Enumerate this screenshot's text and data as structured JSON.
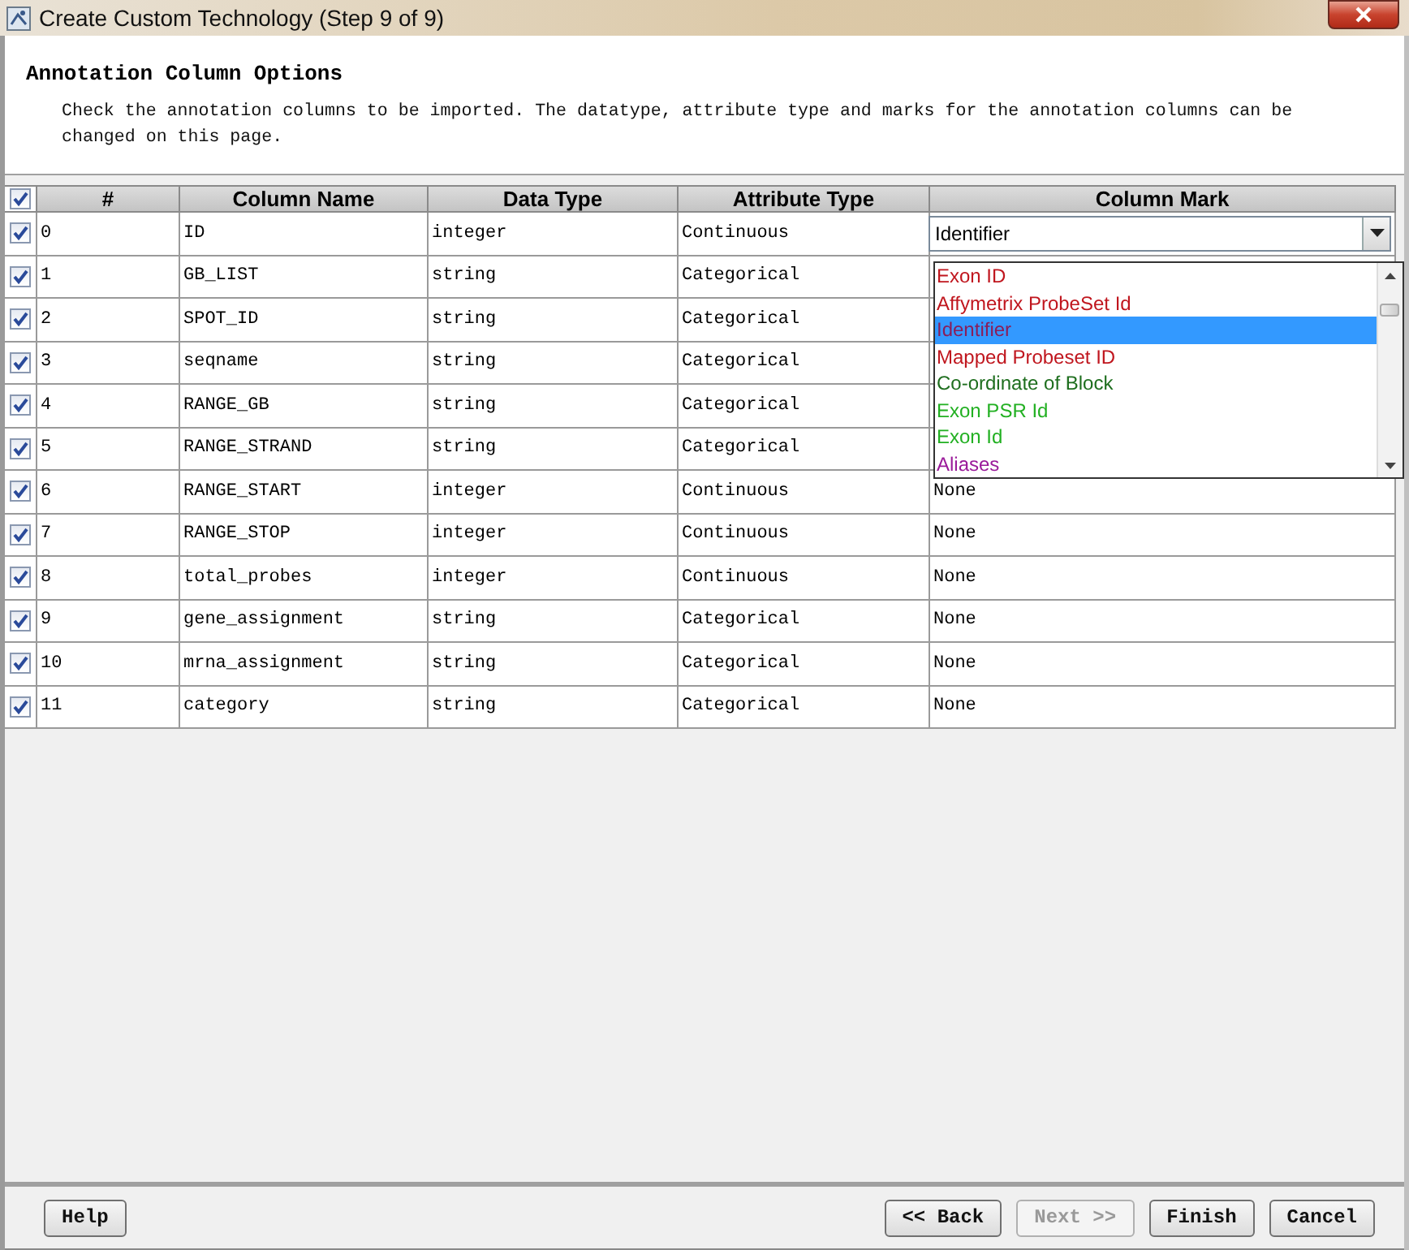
{
  "window": {
    "title": "Create Custom Technology (Step 9 of 9)"
  },
  "header": {
    "title": "Annotation Column Options",
    "description": "Check the annotation columns to be imported. The datatype, attribute type and marks for the annotation columns can be changed on this page."
  },
  "table": {
    "select_all_checked": true,
    "columns": [
      "#",
      "Column Name",
      "Data Type",
      "Attribute Type",
      "Column Mark"
    ],
    "rows": [
      {
        "checked": true,
        "index": "0",
        "name": "ID",
        "data_type": "integer",
        "attribute_type": "Continuous",
        "kind": "combo",
        "mark": "Identifier"
      },
      {
        "checked": true,
        "index": "1",
        "name": "GB_LIST",
        "data_type": "string",
        "attribute_type": "Categorical",
        "kind": "covered"
      },
      {
        "checked": true,
        "index": "2",
        "name": "SPOT_ID",
        "data_type": "string",
        "attribute_type": "Categorical",
        "kind": "covered"
      },
      {
        "checked": true,
        "index": "3",
        "name": "seqname",
        "data_type": "string",
        "attribute_type": "Categorical",
        "kind": "covered"
      },
      {
        "checked": true,
        "index": "4",
        "name": "RANGE_GB",
        "data_type": "string",
        "attribute_type": "Categorical",
        "kind": "covered"
      },
      {
        "checked": true,
        "index": "5",
        "name": "RANGE_STRAND",
        "data_type": "string",
        "attribute_type": "Categorical",
        "kind": "covered"
      },
      {
        "checked": true,
        "index": "6",
        "name": "RANGE_START",
        "data_type": "integer",
        "attribute_type": "Continuous",
        "kind": "text",
        "mark": "None"
      },
      {
        "checked": true,
        "index": "7",
        "name": "RANGE_STOP",
        "data_type": "integer",
        "attribute_type": "Continuous",
        "kind": "text",
        "mark": "None"
      },
      {
        "checked": true,
        "index": "8",
        "name": "total_probes",
        "data_type": "integer",
        "attribute_type": "Continuous",
        "kind": "text",
        "mark": "None"
      },
      {
        "checked": true,
        "index": "9",
        "name": "gene_assignment",
        "data_type": "string",
        "attribute_type": "Categorical",
        "kind": "text",
        "mark": "None"
      },
      {
        "checked": true,
        "index": "10",
        "name": "mrna_assignment",
        "data_type": "string",
        "attribute_type": "Categorical",
        "kind": "text",
        "mark": "None"
      },
      {
        "checked": true,
        "index": "11",
        "name": "category",
        "data_type": "string",
        "attribute_type": "Categorical",
        "kind": "text",
        "mark": "None"
      }
    ]
  },
  "mark_dropdown": {
    "items": [
      {
        "label": "Exon ID",
        "color": "#c0161e",
        "selected": false
      },
      {
        "label": "Affymetrix ProbeSet Id",
        "color": "#c0161e",
        "selected": false
      },
      {
        "label": "Identifier",
        "color": "#8a1e5a",
        "selected": true
      },
      {
        "label": "Mapped Probeset ID",
        "color": "#c0161e",
        "selected": false
      },
      {
        "label": "Co-ordinate of Block",
        "color": "#1e6e1e",
        "selected": false
      },
      {
        "label": "Exon PSR Id",
        "color": "#22b022",
        "selected": false
      },
      {
        "label": "Exon Id",
        "color": "#22b022",
        "selected": false
      },
      {
        "label": "Aliases",
        "color": "#9a1a9a",
        "selected": false
      }
    ]
  },
  "buttons": [
    {
      "label": "Help",
      "disabled": false
    },
    {
      "label": "<< Back",
      "disabled": false
    },
    {
      "label": "Next >>",
      "disabled": true
    },
    {
      "label": "Finish",
      "disabled": false
    },
    {
      "label": "Cancel",
      "disabled": false
    }
  ]
}
